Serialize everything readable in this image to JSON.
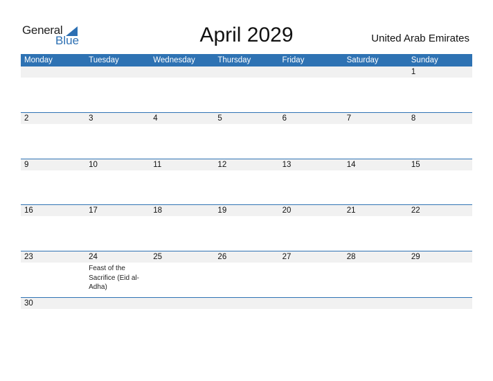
{
  "logo": {
    "line1": "General",
    "line2": "Blue",
    "accent": "#2c6fb3"
  },
  "title": "April 2029",
  "country": "United Arab Emirates",
  "colors": {
    "header_bg": "#2e72b3",
    "date_strip": "#f1f1f1"
  },
  "weekdays": [
    "Monday",
    "Tuesday",
    "Wednesday",
    "Thursday",
    "Friday",
    "Saturday",
    "Sunday"
  ],
  "weeks": [
    {
      "days": [
        "",
        "",
        "",
        "",
        "",
        "",
        "1"
      ],
      "events": [
        "",
        "",
        "",
        "",
        "",
        "",
        ""
      ]
    },
    {
      "days": [
        "2",
        "3",
        "4",
        "5",
        "6",
        "7",
        "8"
      ],
      "events": [
        "",
        "",
        "",
        "",
        "",
        "",
        ""
      ]
    },
    {
      "days": [
        "9",
        "10",
        "11",
        "12",
        "13",
        "14",
        "15"
      ],
      "events": [
        "",
        "",
        "",
        "",
        "",
        "",
        ""
      ]
    },
    {
      "days": [
        "16",
        "17",
        "18",
        "19",
        "20",
        "21",
        "22"
      ],
      "events": [
        "",
        "",
        "",
        "",
        "",
        "",
        ""
      ]
    },
    {
      "days": [
        "23",
        "24",
        "25",
        "26",
        "27",
        "28",
        "29"
      ],
      "events": [
        "",
        "Feast of the Sacrifice (Eid al-Adha)",
        "",
        "",
        "",
        "",
        ""
      ]
    },
    {
      "days": [
        "30",
        "",
        "",
        "",
        "",
        "",
        ""
      ],
      "events": [
        "",
        "",
        "",
        "",
        "",
        "",
        ""
      ]
    }
  ]
}
